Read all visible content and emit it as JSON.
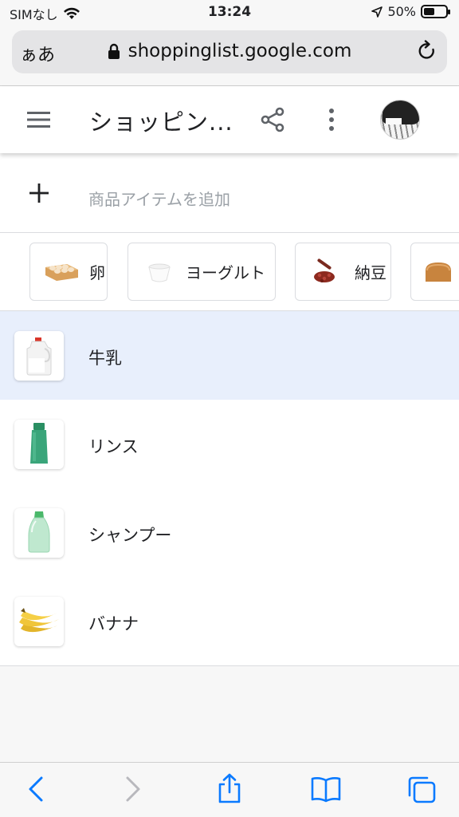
{
  "status_bar": {
    "carrier": "SIMなし",
    "time": "13:24",
    "battery_text": "50%",
    "battery_level": 0.5
  },
  "browser": {
    "text_size_button": "ぁあ",
    "url": "shoppinglist.google.com"
  },
  "app": {
    "title": "ショッピン...",
    "add_placeholder": "商品アイテムを追加"
  },
  "suggestions": [
    {
      "label": "卵",
      "icon": "egg-carton-image"
    },
    {
      "label": "ヨーグルト",
      "icon": "yogurt-image"
    },
    {
      "label": "納豆",
      "icon": "natto-image"
    },
    {
      "label": "",
      "icon": "bread-image"
    }
  ],
  "items": [
    {
      "label": "牛乳",
      "icon": "milk-jug-image",
      "selected": true
    },
    {
      "label": "リンス",
      "icon": "rinse-bottle-image",
      "selected": false
    },
    {
      "label": "シャンプー",
      "icon": "shampoo-bottle-image",
      "selected": false
    },
    {
      "label": "バナナ",
      "icon": "banana-image",
      "selected": false
    }
  ],
  "colors": {
    "accent": "#1a73e8",
    "ios_blue": "#0a7aff",
    "selected_row": "#e8effc",
    "divider": "#dadce0"
  }
}
